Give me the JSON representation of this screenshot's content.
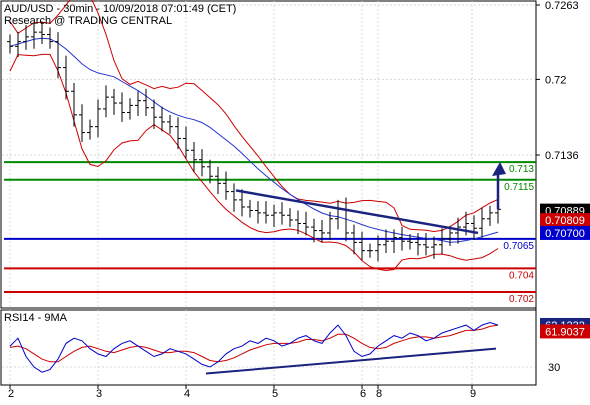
{
  "header": {
    "line1": "AUD/USD - 30min - 10/09/2018 07:01:49 (CET)",
    "line2": "Research @ TRADING CENTRAL"
  },
  "colors": {
    "candles": "#000000",
    "bollinger": "#cc0000",
    "moving_average": "#2233cc",
    "trendline": "#1a237e",
    "resistance": "#008800",
    "pivot": "#0000cc",
    "support": "#cc0000",
    "last_price_tag": "#000000",
    "rsi_line": "#0000cc",
    "rsi_signal": "#cc0000",
    "rsi_tag": "#1a237e",
    "rsi_signal_tag": "#cc0000",
    "grid": "#d8d8d8"
  },
  "chart_data": [
    {
      "type": "candlestick",
      "title": "AUD/USD - 30min - 10/09/2018 07:01:49 (CET)",
      "subtitle": "Research @ TRADING CENTRAL",
      "ylim": [
        0.7,
        0.7275
      ],
      "y_ticks": [
        0.7263,
        0.72,
        0.7136
      ],
      "x_ticks": [
        "2",
        "3",
        "4",
        "5",
        "6",
        "8",
        "9"
      ],
      "grid": true,
      "overlays": [
        "Bollinger bands",
        "moving average",
        "trendline",
        "forecast arrow"
      ],
      "horizontal_levels": [
        {
          "value": 0.713,
          "label": "0.713",
          "role": "resistance"
        },
        {
          "value": 0.7115,
          "label": "0.7115",
          "role": "resistance"
        },
        {
          "value": 0.7065,
          "label": "0.7065",
          "role": "pivot"
        },
        {
          "value": 0.704,
          "label": "0.704",
          "role": "support"
        },
        {
          "value": 0.702,
          "label": "0.702",
          "role": "support"
        }
      ],
      "price_tags": [
        "0.70889",
        "0.70809",
        "0.70700"
      ],
      "series": [
        {
          "values": [
            0.7228,
            0.7232,
            0.7236,
            0.724,
            0.7238,
            0.7232,
            0.721,
            0.719,
            0.717,
            0.7155,
            0.716,
            0.7175,
            0.7185,
            0.718,
            0.7172,
            0.7178,
            0.7182,
            0.7176,
            0.7168,
            0.7164,
            0.716,
            0.715,
            0.714,
            0.7132,
            0.7126,
            0.7118,
            0.7112,
            0.7105,
            0.7098,
            0.7092,
            0.7089,
            0.7087,
            0.7085,
            0.7087,
            0.7085,
            0.7081,
            0.7078,
            0.7075,
            0.7072,
            0.707,
            0.7082,
            0.709,
            0.707,
            0.7062,
            0.7055,
            0.7055,
            0.706,
            0.7063,
            0.7066,
            0.7063,
            0.7062,
            0.706,
            0.7058,
            0.706,
            0.7065,
            0.707,
            0.7075,
            0.7078,
            0.7074,
            0.7082,
            0.7087,
            0.709
          ]
        }
      ]
    },
    {
      "type": "line",
      "title": "RSI14 - 9MA",
      "ylim": [
        22,
        76
      ],
      "y_ticks": [
        30
      ],
      "value_tags": [
        "62.1232",
        "61.9037"
      ],
      "series": [
        {
          "values": [
            46,
            52,
            38,
            30,
            26,
            28,
            36,
            48,
            52,
            50,
            44,
            40,
            38,
            44,
            48,
            50,
            46,
            42,
            38,
            40,
            44,
            42,
            40,
            36,
            32,
            30,
            34,
            40,
            44,
            46,
            50,
            48,
            52,
            50,
            46,
            48,
            52,
            54,
            50,
            48,
            56,
            62,
            54,
            42,
            38,
            40,
            46,
            50,
            54,
            52,
            56,
            54,
            50,
            52,
            56,
            58,
            60,
            62,
            58,
            62,
            64,
            62
          ]
        },
        {
          "values": [
            45,
            46,
            44,
            40,
            36,
            34,
            34,
            38,
            42,
            45,
            46,
            44,
            42,
            41,
            43,
            45,
            46,
            45,
            43,
            41,
            41,
            42,
            42,
            41,
            38,
            35,
            34,
            35,
            37,
            40,
            43,
            45,
            47,
            48,
            48,
            48,
            49,
            51,
            51,
            50,
            52,
            55,
            55,
            52,
            48,
            45,
            44,
            45,
            48,
            50,
            52,
            53,
            53,
            52,
            53,
            54,
            56,
            58,
            58,
            59,
            61,
            62
          ]
        }
      ],
      "overlays": [
        "rising trendline"
      ]
    }
  ]
}
